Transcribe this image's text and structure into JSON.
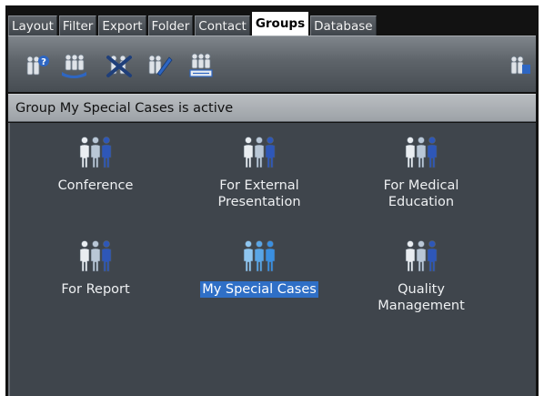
{
  "tabs": [
    {
      "label": "Layout",
      "active": false
    },
    {
      "label": "Filter",
      "active": false
    },
    {
      "label": "Export",
      "active": false
    },
    {
      "label": "Folder",
      "active": false
    },
    {
      "label": "Contact",
      "active": false
    },
    {
      "label": "Groups",
      "active": true
    },
    {
      "label": "Database",
      "active": false
    }
  ],
  "toolbar": {
    "buttons": [
      {
        "name": "new-group-icon"
      },
      {
        "name": "group-settings-icon"
      },
      {
        "name": "delete-group-icon"
      },
      {
        "name": "edit-group-icon"
      },
      {
        "name": "group-list-icon"
      },
      {
        "name": "group-info-icon"
      }
    ]
  },
  "status": {
    "text": "Group My Special Cases is active"
  },
  "groups": [
    {
      "label": "Conference",
      "selected": false
    },
    {
      "label": "For External\nPresentation",
      "selected": false
    },
    {
      "label": "For Medical\nEducation",
      "selected": false
    },
    {
      "label": "For Report",
      "selected": false
    },
    {
      "label": "My Special Cases",
      "selected": true
    },
    {
      "label": "Quality\nManagement",
      "selected": false
    }
  ],
  "colors": {
    "accent": "#2f6fc6",
    "content_bg": "#3f454c",
    "selected_icon": "#3a8fe0"
  }
}
